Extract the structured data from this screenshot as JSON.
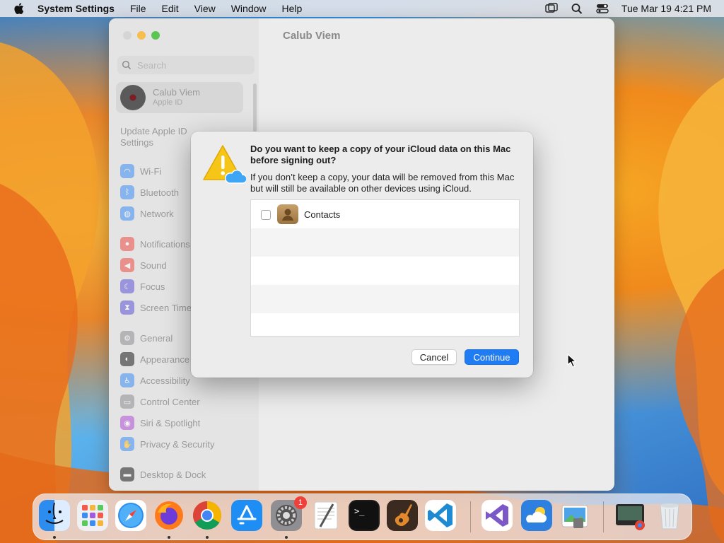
{
  "menubar": {
    "app_name": "System Settings",
    "menus": [
      "File",
      "Edit",
      "View",
      "Window",
      "Help"
    ],
    "clock": "Tue Mar 19  4:21 PM"
  },
  "settings_window": {
    "title": "Calub Viem",
    "search_placeholder": "Search",
    "account": {
      "name": "Calub Viem",
      "subtitle": "Apple ID"
    },
    "update_notice": "Update Apple ID Settings",
    "sidebar_items": [
      {
        "label": "Wi-Fi",
        "color": "#3d8ef7"
      },
      {
        "label": "Bluetooth",
        "color": "#3d8ef7"
      },
      {
        "label": "Network",
        "color": "#3d8ef7"
      },
      {
        "label": "Notifications",
        "color": "#ee4b45"
      },
      {
        "label": "Sound",
        "color": "#ee4b45"
      },
      {
        "label": "Focus",
        "color": "#5c54d6"
      },
      {
        "label": "Screen Time",
        "color": "#5c54d6"
      },
      {
        "label": "General",
        "color": "#8e8e93"
      },
      {
        "label": "Appearance",
        "color": "#1c1c1e"
      },
      {
        "label": "Accessibility",
        "color": "#3d8ef7"
      },
      {
        "label": "Control Center",
        "color": "#8e8e93"
      },
      {
        "label": "Siri & Spotlight",
        "color": "#b14fd6"
      },
      {
        "label": "Privacy & Security",
        "color": "#3d8ef7"
      },
      {
        "label": "Desktop & Dock",
        "color": "#1c1c1e"
      }
    ]
  },
  "dialog": {
    "title": "Do you want to keep a copy of your iCloud data on this Mac before signing out?",
    "message": "If you don’t keep a copy, your data will be removed from this Mac but will still be available on other devices using iCloud.",
    "items": [
      {
        "label": "Contacts",
        "checked": false
      }
    ],
    "cancel_label": "Cancel",
    "continue_label": "Continue",
    "accent_color": "#1f7cf3"
  },
  "dock": {
    "apps": [
      {
        "name": "finder-icon",
        "running": true
      },
      {
        "name": "launchpad-icon",
        "running": false
      },
      {
        "name": "safari-icon",
        "running": false
      },
      {
        "name": "firefox-icon",
        "running": true
      },
      {
        "name": "chrome-icon",
        "running": true
      },
      {
        "name": "app-store-icon",
        "running": false
      },
      {
        "name": "system-settings-icon",
        "running": true
      },
      {
        "name": "textedit-icon",
        "running": false
      },
      {
        "name": "terminal-icon",
        "running": false
      },
      {
        "name": "garageband-icon",
        "running": false
      },
      {
        "name": "vscode-icon",
        "running": false
      },
      {
        "name": "visual-studio-icon",
        "running": false
      },
      {
        "name": "weather-icon",
        "running": false
      },
      {
        "name": "preview-icon",
        "running": false
      },
      {
        "name": "screenshot-chrome-icon",
        "running": false
      },
      {
        "name": "trash-icon",
        "running": false
      }
    ],
    "settings_badge": "1"
  }
}
